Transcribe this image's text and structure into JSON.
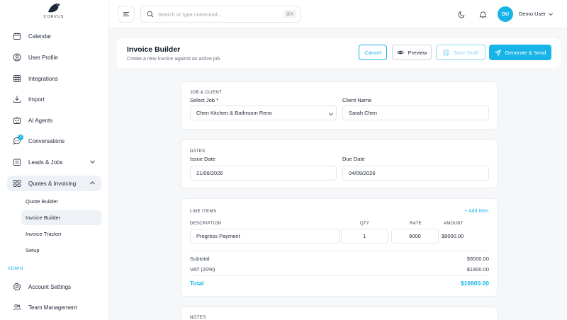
{
  "brand": {
    "name": "CORVUS"
  },
  "sidebar": {
    "items": [
      {
        "label": "Calendar",
        "icon": "calendar-icon"
      },
      {
        "label": "User Profile",
        "icon": "user-circle-icon"
      },
      {
        "label": "Integrations",
        "icon": "grid-table-icon"
      },
      {
        "label": "Import",
        "icon": "download-icon"
      },
      {
        "label": "AI Agents",
        "icon": "robot-icon"
      },
      {
        "label": "Conversations",
        "icon": "chat-bubble-icon",
        "badge": "3"
      },
      {
        "label": "Leads & Jobs",
        "icon": "clipboard-icon"
      },
      {
        "label": "Quotes & Invoicing",
        "icon": "apps-icon"
      }
    ],
    "sub_items": [
      {
        "label": "Quote Builder"
      },
      {
        "label": "Invoice Builder"
      },
      {
        "label": "Invoice Tracker"
      },
      {
        "label": "Setup"
      }
    ],
    "admin_label": "ADMIN",
    "admin_items": [
      {
        "label": "Account Settings",
        "icon": "gear-icon"
      },
      {
        "label": "Team Management",
        "icon": "users-icon"
      }
    ]
  },
  "topbar": {
    "search_placeholder": "Search or type command...",
    "search_shortcut": "⌘K",
    "user_initials": "DU",
    "user_name": "Demo User"
  },
  "header": {
    "title": "Invoice Builder",
    "subtitle": "Create a new invoice against an active job",
    "cancel_label": "Cancel",
    "preview_label": "Preview",
    "draft_label": "Save Draft",
    "send_label": "Generate & Send"
  },
  "job_client": {
    "section_label": "JOB & CLIENT",
    "job_label": "Select Job *",
    "job_value": "Chen Kitchen & Bathroom Reno",
    "client_label": "Client Name",
    "client_value": "Sarah Chen"
  },
  "dates": {
    "section_label": "DATES",
    "issue_label": "Issue Date",
    "issue_value": "21/08/2026",
    "due_label": "Due Date",
    "due_value": "04/09/2026"
  },
  "line_items": {
    "section_label": "LINE ITEMS",
    "add_label": "+ Add Item",
    "col_description": "DESCRIPTION",
    "col_qty": "QTY",
    "col_rate": "RATE",
    "col_amount": "AMOUNT",
    "rows": [
      {
        "description": "Progress Payment",
        "qty": "1",
        "rate": "9000",
        "amount": "$9000.00"
      }
    ],
    "subtotal_label": "Subtotal",
    "subtotal_value": "$9000.00",
    "vat_label": "VAT (20%)",
    "vat_value": "$1800.00",
    "total_label": "Total",
    "total_value": "$10800.00"
  },
  "notes": {
    "section_label": "NOTES"
  },
  "colors": {
    "accent": "#18b4e8",
    "active_bg": "#eef2f6"
  }
}
